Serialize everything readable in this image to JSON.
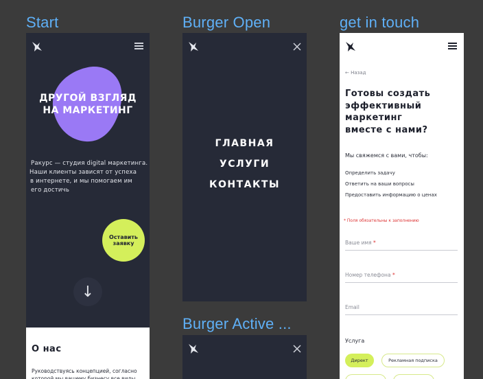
{
  "labels": {
    "start": "Start",
    "burger_open": "Burger Open",
    "get_in_touch": "get in touch",
    "burger_active": "Burger Active ..."
  },
  "start": {
    "hero_title_line1": "ДРУГОЙ ВЗГЛЯД",
    "hero_title_line2": "НА МАРКЕТИНГ",
    "hero_text": [
      "Ракурс — студия digital маркетинга.",
      "Наши клиенты зависят от успеха",
      "в интернете, и мы помогаем им",
      "его достичь"
    ],
    "cta_line1": "Оставить",
    "cta_line2": "заявку",
    "down_arrow": "↓",
    "about_title": "О нас",
    "about_text": "Руководствуясь концепцией, согласно которой мы вашему бизнесу все виды"
  },
  "menu": {
    "items": [
      "ГЛАВНАЯ",
      "УСЛУГИ",
      "КОНТАКТЫ"
    ]
  },
  "contact": {
    "back": "← Назад",
    "title_lines": [
      "Готовы создать",
      "эффективный",
      "маркетинг",
      "вместе с нами?"
    ],
    "intro": "Мы свяжемся с вами, чтобы:",
    "points": [
      "Определить задачу",
      "Ответить на ваши вопросы",
      "Предоставить информацию о ценах"
    ],
    "required_note": "* Поля обязательны к заполнению",
    "fields": {
      "name": "Ваше имя",
      "phone": "Номер телефона",
      "email": "Email"
    },
    "required_star": "*",
    "service_label": "Услуга",
    "chips": [
      "Директ",
      "Рекламная подписка"
    ]
  },
  "colors": {
    "accent_purple": "#9a79f5",
    "accent_lime": "#d4ef5b",
    "dark_bg": "#262a37",
    "label_blue": "#5fb0f7"
  }
}
